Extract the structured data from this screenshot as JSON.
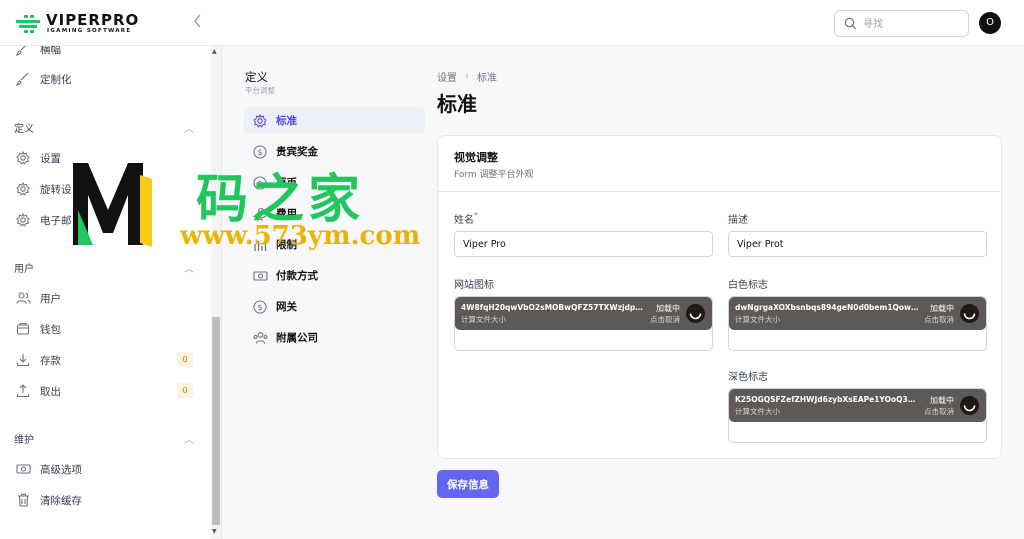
{
  "brand": {
    "name": "VIPERPRO",
    "tagline": "IGAMING SOFTWARE"
  },
  "header": {
    "search_placeholder": "寻找",
    "avatar_initial": "O"
  },
  "sidebar": {
    "items_top": [
      {
        "label": "横幅",
        "icon": "brush-icon"
      },
      {
        "label": "定制化",
        "icon": "brush-icon"
      }
    ],
    "sections": [
      {
        "title": "定义",
        "items": [
          {
            "label": "设置",
            "icon": "gear-icon"
          },
          {
            "label": "旋转设",
            "icon": "gear-icon"
          },
          {
            "label": "电子邮",
            "icon": "gear-icon"
          }
        ]
      },
      {
        "title": "用户",
        "items": [
          {
            "label": "用户",
            "icon": "users-icon"
          },
          {
            "label": "钱包",
            "icon": "wallet-icon"
          },
          {
            "label": "存款",
            "icon": "download-icon",
            "badge": "0"
          },
          {
            "label": "取出",
            "icon": "upload-icon",
            "badge": "0"
          }
        ]
      },
      {
        "title": "维护",
        "items": [
          {
            "label": "高级选项",
            "icon": "banknote-icon"
          },
          {
            "label": "清除缓存",
            "icon": "trash-icon"
          }
        ]
      }
    ]
  },
  "subnav": {
    "title": "定义",
    "subtitle": "平台调整",
    "items": [
      {
        "label": "标准",
        "icon": "gear-icon",
        "active": true
      },
      {
        "label": "贵宾奖金",
        "icon": "dollar-icon"
      },
      {
        "label": "原币",
        "icon": "dollar-icon"
      },
      {
        "label": "费用",
        "icon": "hand-coin-icon"
      },
      {
        "label": "限制",
        "icon": "bars-icon"
      },
      {
        "label": "付款方式",
        "icon": "banknote-icon"
      },
      {
        "label": "网关",
        "icon": "dollar-icon"
      },
      {
        "label": "附属公司",
        "icon": "users-icon"
      }
    ]
  },
  "breadcrumb": {
    "parent": "设置",
    "current": "标准"
  },
  "page_title": "标准",
  "card": {
    "title": "视觉调整",
    "subtitle": "Form 调整平台外观",
    "fields": {
      "name": {
        "label": "姓名",
        "required_mark": "*",
        "value": "Viper Pro"
      },
      "description": {
        "label": "描述",
        "value": "Viper Prot"
      },
      "favicon": {
        "label": "网站图标",
        "file": "4W8fqH20qwVbO2sMOBwQFZ57TXWzjdpKFOLKWN...",
        "size_text": "计算文件大小",
        "state": "加载中",
        "cancel": "点击取消"
      },
      "logo_white": {
        "label": "白色标志",
        "file": "dwNgrgaXOXbsnbqs894geN0d0bem1QowGDUzsIT...",
        "size_text": "计算文件大小",
        "state": "加载中",
        "cancel": "点击取消"
      },
      "logo_dark": {
        "label": "深色标志",
        "file": "K25OGQSFZefZHWJd6zybXsEAPe1YOoQ3TkEw1LA...",
        "size_text": "计算文件大小",
        "state": "加载中",
        "cancel": "点击取消"
      }
    }
  },
  "save_label": "保存信息",
  "watermark": {
    "text_cn": "码之家",
    "text_url": "www.573ym.com"
  },
  "colors": {
    "accent": "#6366f1",
    "active_nav": "#4f46e5",
    "upload_bg": "#5e5957",
    "badge": "#d97706"
  }
}
